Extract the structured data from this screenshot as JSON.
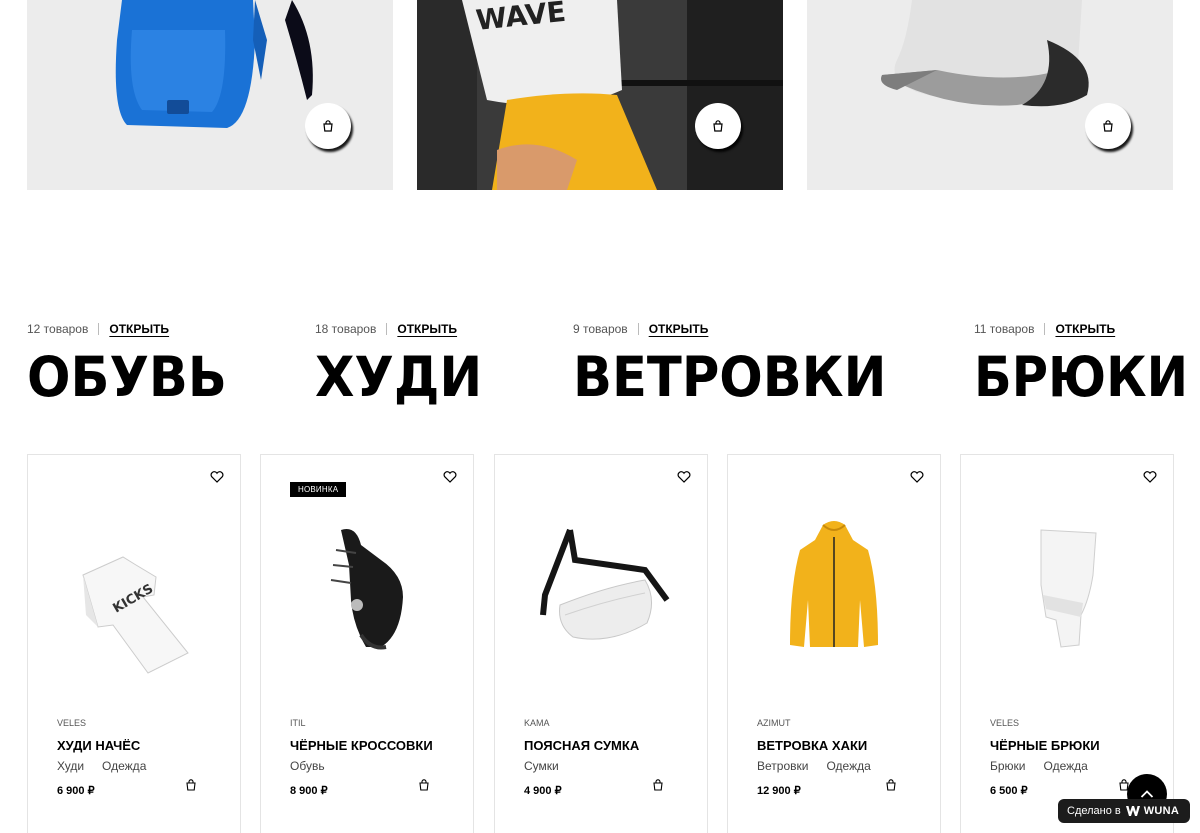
{
  "banners": [
    {
      "cart_icon": "shopping-bag-icon"
    },
    {
      "cart_icon": "shopping-bag-icon"
    },
    {
      "cart_icon": "shopping-bag-icon"
    }
  ],
  "categories": [
    {
      "count": "12 товаров",
      "open_label": "ОТКРЫТЬ",
      "title": "ОБУВЬ"
    },
    {
      "count": "18 товаров",
      "open_label": "ОТКРЫТЬ",
      "title": "ХУДИ"
    },
    {
      "count": "9 товаров",
      "open_label": "ОТКРЫТЬ",
      "title": "ВЕТРОВКИ"
    },
    {
      "count": "11 товаров",
      "open_label": "ОТКРЫТЬ",
      "title": "БРЮКИ"
    }
  ],
  "products": [
    {
      "brand": "VELES",
      "name": "ХУДИ НАЧЁС",
      "tags": [
        "Худи",
        "Одежда"
      ],
      "price": "6 900 ₽",
      "badge": ""
    },
    {
      "brand": "ITIL",
      "name": "ЧЁРНЫЕ КРОССОВКИ",
      "tags": [
        "Обувь"
      ],
      "price": "8 900 ₽",
      "badge": "НОВИНКА"
    },
    {
      "brand": "KAMA",
      "name": "ПОЯСНАЯ СУМКА",
      "tags": [
        "Сумки"
      ],
      "price": "4 900 ₽",
      "badge": ""
    },
    {
      "brand": "AZIMUT",
      "name": "ВЕТРОВКА ХАКИ",
      "tags": [
        "Ветровки",
        "Одежда"
      ],
      "price": "12 900 ₽",
      "badge": ""
    },
    {
      "brand": "VELES",
      "name": "ЧЁРНЫЕ БРЮКИ",
      "tags": [
        "Брюки",
        "Одежда"
      ],
      "price": "6 500 ₽",
      "badge": ""
    }
  ],
  "footer": {
    "made_in_label": "Сделано в",
    "made_in_brand": "WUNA",
    "scroll_top_icon": "chevron-up-icon"
  },
  "colors": {
    "accent": "#000000",
    "yellow": "#f2b21b",
    "blue": "#1b6fd0"
  }
}
